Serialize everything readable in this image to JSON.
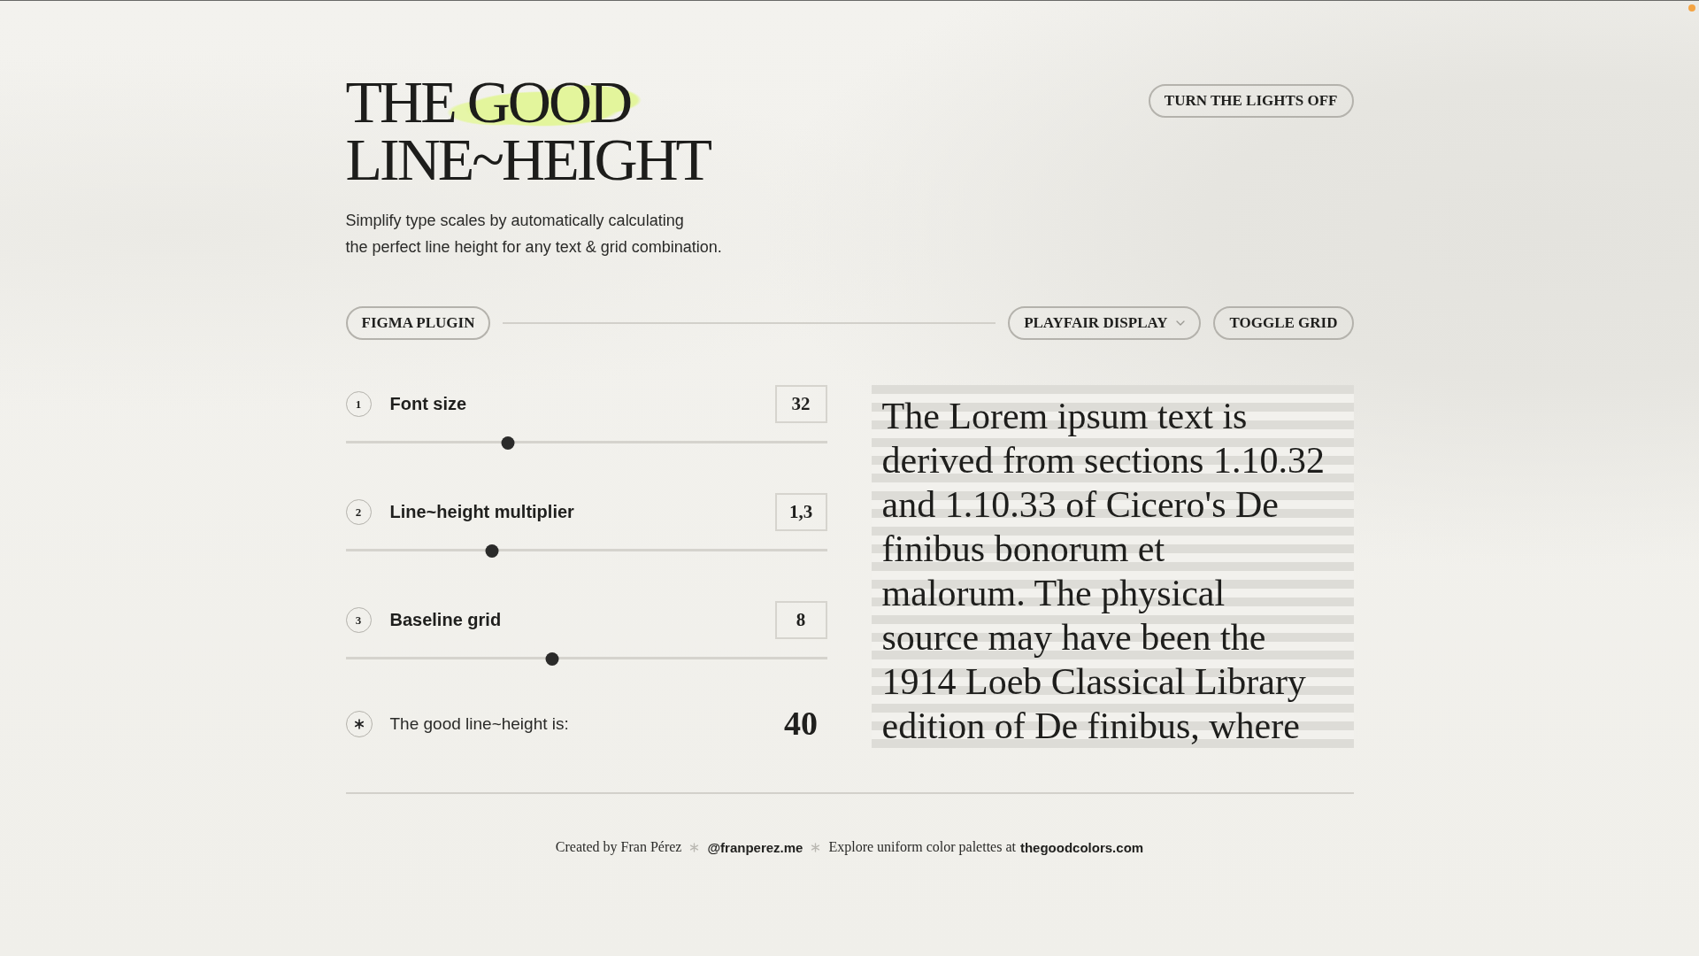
{
  "header": {
    "title_lines": [
      "THE GOOD",
      "LINE~HEIGHT"
    ],
    "subtitle_lines": [
      "Simplify type scales by automatically calculating",
      "the perfect line height for any text & grid combination."
    ],
    "theme_button": "TURN THE LIGHTS OFF"
  },
  "toolbar": {
    "plugin_button": "FIGMA PLUGIN",
    "font_dropdown": "PLAYFAIR DISPLAY",
    "grid_button": "TOGGLE GRID"
  },
  "controls": [
    {
      "number": "1",
      "label": "Font size",
      "value": "32",
      "level": 0.338
    },
    {
      "number": "2",
      "label": "Line~height multiplier",
      "value": "1,3",
      "level": 0.305
    },
    {
      "number": "3",
      "label": "Baseline grid",
      "value": "8",
      "level": 0.43
    }
  ],
  "result": {
    "label": "The good line~height is:",
    "value": "40"
  },
  "preview": {
    "grid_visible": true,
    "lines": [
      "The Lorem ipsum text is",
      "derived from sections 1.10.32",
      "and 1.10.33 of Cicero's De",
      "finibus bonorum et",
      "malorum. The physical",
      "source may have been the",
      "1914 Loeb Classical Library",
      "edition of De finibus, where"
    ]
  },
  "footer": [
    {
      "kind": "text",
      "text": "Created by Fran Pérez"
    },
    {
      "kind": "separator"
    },
    {
      "kind": "link",
      "text": "@franperez.me"
    },
    {
      "kind": "separator"
    },
    {
      "kind": "text",
      "text": "Explore uniform color palettes at"
    },
    {
      "kind": "link",
      "text": "thegoodcolors.com"
    }
  ]
}
